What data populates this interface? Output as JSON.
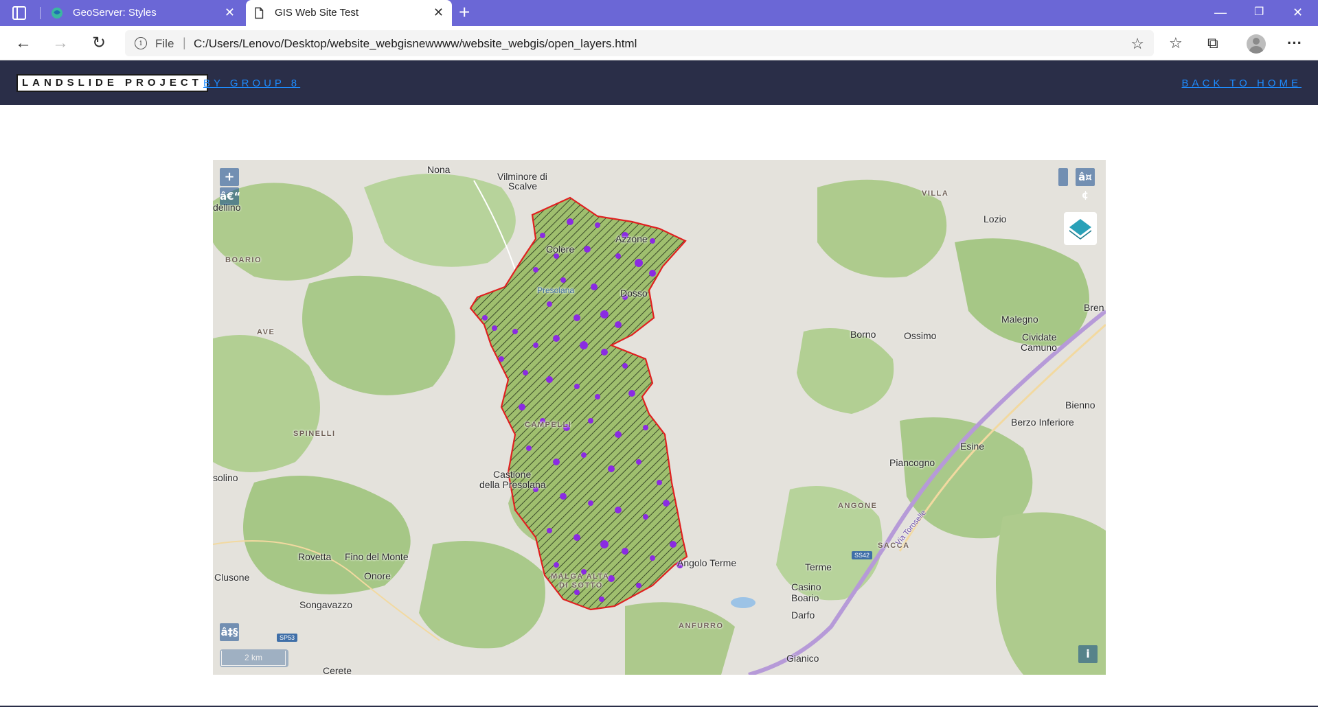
{
  "browser": {
    "tabs": [
      {
        "title": "GeoServer: Styles",
        "active": false,
        "icon": "geoserver-icon"
      },
      {
        "title": "GIS Web Site Test",
        "active": true,
        "icon": "page-icon"
      }
    ],
    "address": {
      "scheme_label": "File",
      "url": "C:/Users/Lenovo/Desktop/website_webgisnewwww/website_webgis/open_layers.html"
    }
  },
  "site": {
    "brand": "LANDSLIDE PROJECT",
    "byline": "BY GROUP 8",
    "back_link": "BACK TO HOME"
  },
  "map": {
    "controls": {
      "zoom_in": "+",
      "zoom_out": "â€“",
      "rotate": "â‡§",
      "fullscreen": "â¤¢",
      "attribution": "i"
    },
    "scale_label": "2 km",
    "places": [
      {
        "name": "Nona"
      },
      {
        "name": "Vilminore di"
      },
      {
        "name": "Scalve"
      },
      {
        "name": "VILLA"
      },
      {
        "name": "Lozio"
      },
      {
        "name": "dellino"
      },
      {
        "name": "BOARIO"
      },
      {
        "name": "Azzone"
      },
      {
        "name": "Colere"
      },
      {
        "name": "Presolana"
      },
      {
        "name": "Dosso"
      },
      {
        "name": "Bren"
      },
      {
        "name": "Malegno"
      },
      {
        "name": "AVE"
      },
      {
        "name": "Borno"
      },
      {
        "name": "Ossimo"
      },
      {
        "name": "Cividate"
      },
      {
        "name": "Camuno"
      },
      {
        "name": "Bienno"
      },
      {
        "name": "Berzo Inferiore"
      },
      {
        "name": "SPINELLI"
      },
      {
        "name": "CAMPELLI"
      },
      {
        "name": "Esine"
      },
      {
        "name": "Piancogno"
      },
      {
        "name": "Castione"
      },
      {
        "name": "della Presolana"
      },
      {
        "name": "solino"
      },
      {
        "name": "ANGONE"
      },
      {
        "name": "SACCA"
      },
      {
        "name": "Rovetta"
      },
      {
        "name": "Fino del Monte"
      },
      {
        "name": "Clusone"
      },
      {
        "name": "Onore"
      },
      {
        "name": "MALGA ALTA"
      },
      {
        "name": "DI SOTTO"
      },
      {
        "name": "Angolo Terme"
      },
      {
        "name": "Terme"
      },
      {
        "name": "Casino"
      },
      {
        "name": "Boario"
      },
      {
        "name": "Darfo"
      },
      {
        "name": "Songavazzo"
      },
      {
        "name": "ANFURRO"
      },
      {
        "name": "Gianico"
      },
      {
        "name": "Cerete"
      },
      {
        "name": "Via Toroselle"
      }
    ],
    "road_shields": [
      "SP53",
      "SS42"
    ],
    "colors": {
      "boundary": "#e02020",
      "landslide_points": "#8a2be2",
      "forest": "#a9c98a",
      "terrain": "#e3e1dc"
    }
  }
}
